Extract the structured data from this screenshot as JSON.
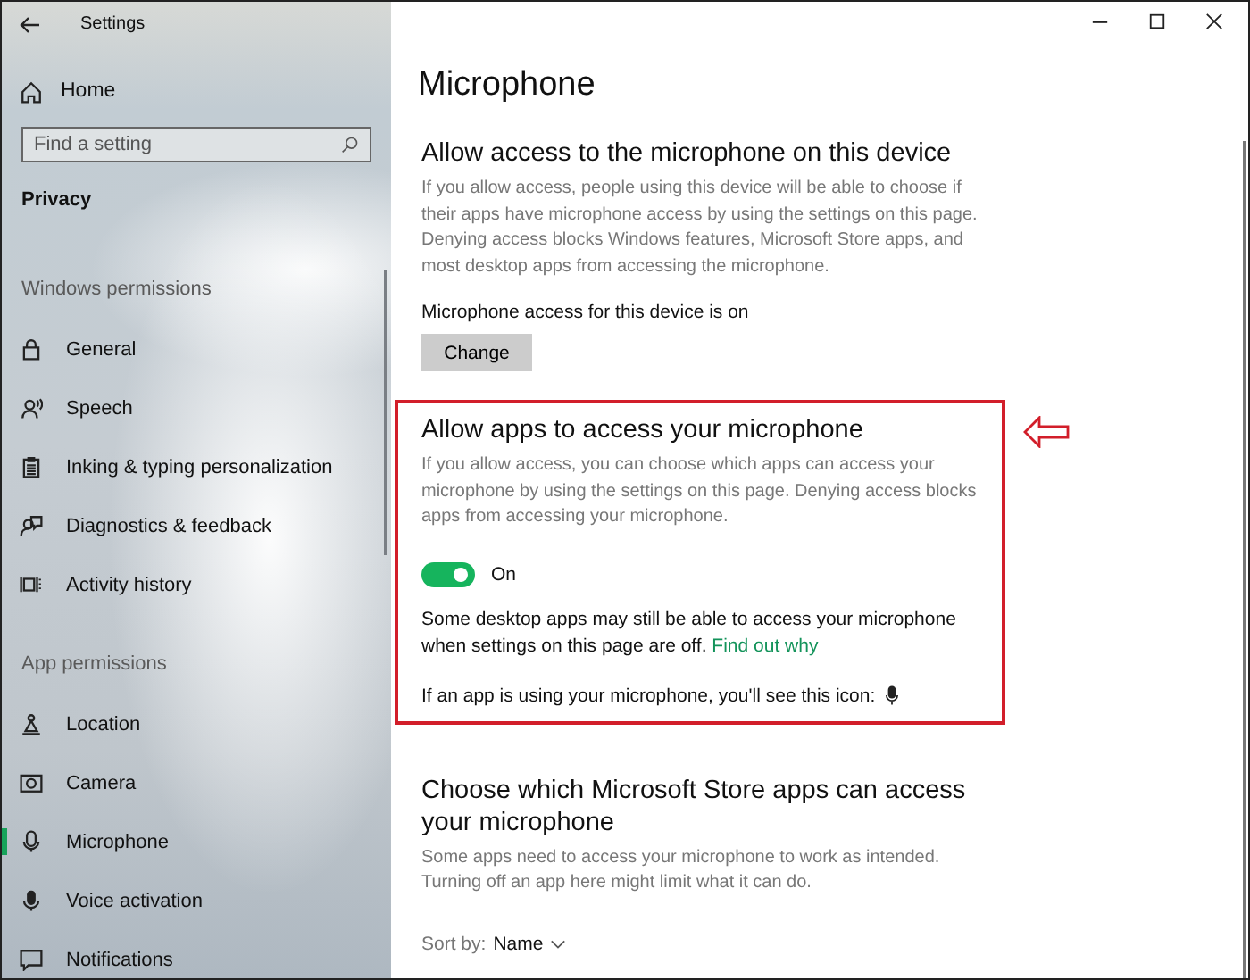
{
  "window": {
    "title": "Settings"
  },
  "sidebar": {
    "home": "Home",
    "search": {
      "placeholder": "Find a setting"
    },
    "category": "Privacy",
    "groups": [
      {
        "heading": "Windows permissions",
        "items": [
          {
            "label": "General",
            "selected": false
          },
          {
            "label": "Speech",
            "selected": false
          },
          {
            "label": "Inking & typing personalization",
            "selected": false
          },
          {
            "label": "Diagnostics & feedback",
            "selected": false
          },
          {
            "label": "Activity history",
            "selected": false
          }
        ]
      },
      {
        "heading": "App permissions",
        "items": [
          {
            "label": "Location",
            "selected": false
          },
          {
            "label": "Camera",
            "selected": false
          },
          {
            "label": "Microphone",
            "selected": true
          },
          {
            "label": "Voice activation",
            "selected": false
          },
          {
            "label": "Notifications",
            "selected": false
          }
        ]
      }
    ]
  },
  "page": {
    "title": "Microphone",
    "sections": [
      {
        "kind": "device",
        "highlighted": false,
        "heading": "Allow access to the microphone on this device",
        "description": "If you allow access, people using this device will be able to choose if their apps have microphone access by using the settings on this page. Denying access blocks Windows features, Microsoft Store apps, and most desktop apps from accessing the microphone.",
        "status": "Microphone access for this device is on",
        "button": "Change"
      },
      {
        "kind": "apps",
        "highlighted": true,
        "heading": "Allow apps to access your microphone",
        "description": "If you allow access, you can choose which apps can access your microphone by using the settings on this page. Denying access blocks apps from accessing your microphone.",
        "toggle": {
          "on": true,
          "label": "On"
        },
        "note": {
          "text": "Some desktop apps may still be able to access your microphone when settings on this page are off.",
          "link": "Find out why"
        },
        "indicator": "If an app is using your microphone, you'll see this icon:"
      },
      {
        "kind": "store",
        "highlighted": false,
        "heading": "Choose which Microsoft Store apps can access your microphone",
        "description": "Some apps need to access your microphone to work as intended. Turning off an app here might limit what it can do.",
        "sort": {
          "label": "Sort by:",
          "value": "Name"
        }
      }
    ]
  }
}
